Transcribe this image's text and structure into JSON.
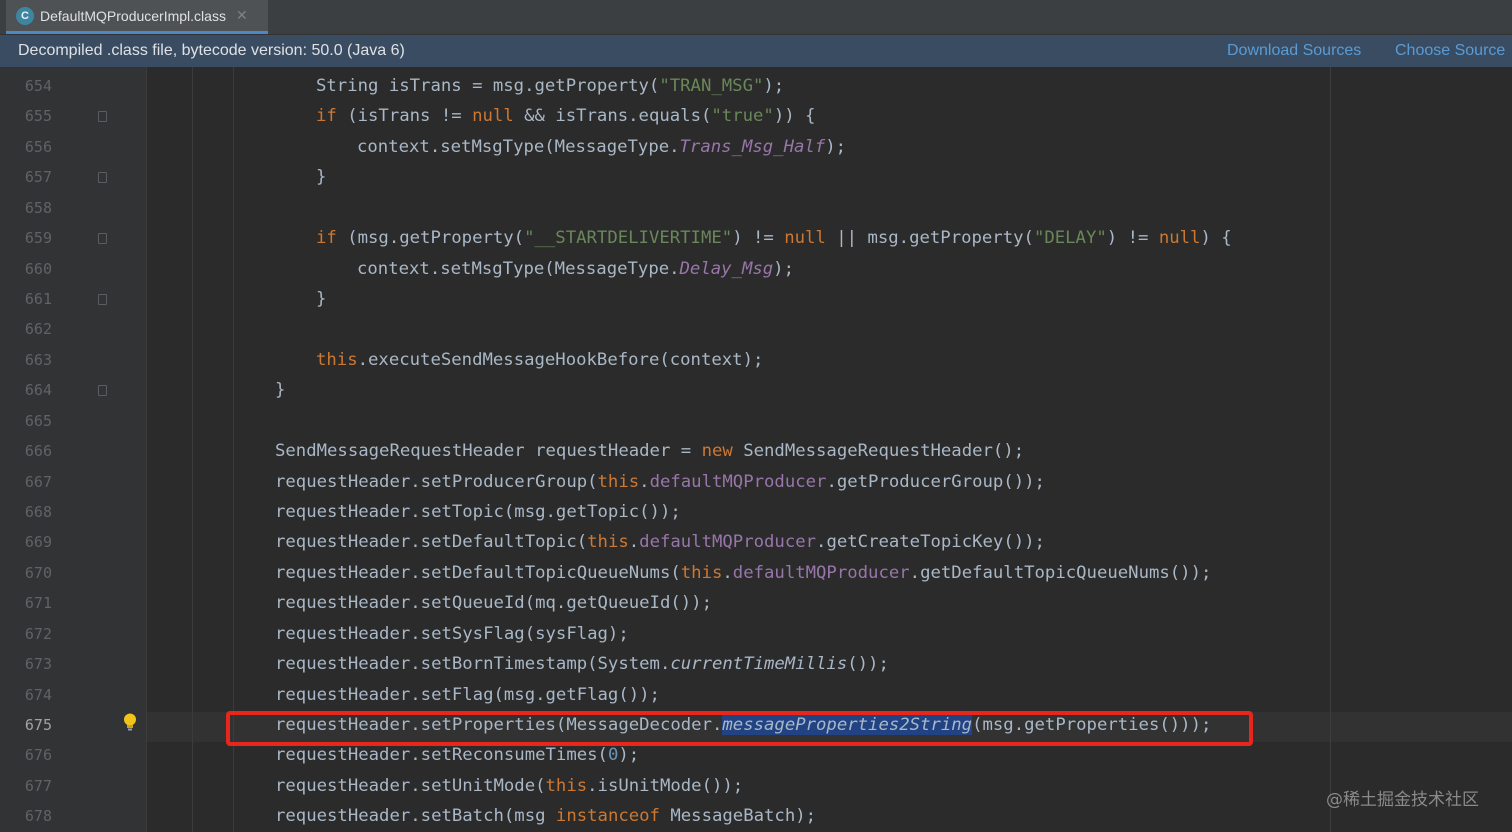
{
  "tab": {
    "icon_letter": "C",
    "file_name": "DefaultMQProducerImpl.class",
    "close_glyph": "✕"
  },
  "info_bar": {
    "text": "Decompiled .class file, bytecode version: 50.0 (Java 6)",
    "download_sources": "Download Sources",
    "choose_sources": "Choose Source"
  },
  "editor": {
    "current_line": 675,
    "line_numbers": [
      "654",
      "655",
      "656",
      "657",
      "658",
      "659",
      "660",
      "661",
      "662",
      "663",
      "664",
      "665",
      "666",
      "667",
      "668",
      "669",
      "670",
      "671",
      "672",
      "673",
      "674",
      "675",
      "676",
      "677",
      "678"
    ]
  },
  "code": {
    "l654": [
      {
        "t": "String isTrans = msg.getProperty("
      },
      {
        "t": "\"TRAN_MSG\"",
        "c": "str"
      },
      {
        "t": ");"
      }
    ],
    "l655": [
      {
        "t": "if",
        "c": "kw"
      },
      {
        "t": " (isTrans != "
      },
      {
        "t": "null",
        "c": "kw"
      },
      {
        "t": " && isTrans.equals("
      },
      {
        "t": "\"true\"",
        "c": "str"
      },
      {
        "t": ")) {"
      }
    ],
    "l656": [
      {
        "t": "context.setMsgType(MessageType."
      },
      {
        "t": "Trans_Msg_Half",
        "c": "ifld"
      },
      {
        "t": ");"
      }
    ],
    "l657": [
      {
        "t": "}"
      }
    ],
    "l658": [],
    "l659": [
      {
        "t": "if",
        "c": "kw"
      },
      {
        "t": " (msg.getProperty("
      },
      {
        "t": "\"__STARTDELIVERTIME\"",
        "c": "str"
      },
      {
        "t": ") != "
      },
      {
        "t": "null",
        "c": "kw"
      },
      {
        "t": " || msg.getProperty("
      },
      {
        "t": "\"DELAY\"",
        "c": "str"
      },
      {
        "t": ") != "
      },
      {
        "t": "null",
        "c": "kw"
      },
      {
        "t": ") {"
      }
    ],
    "l660": [
      {
        "t": "context.setMsgType(MessageType."
      },
      {
        "t": "Delay_Msg",
        "c": "ifld"
      },
      {
        "t": ");"
      }
    ],
    "l661": [
      {
        "t": "}"
      }
    ],
    "l662": [],
    "l663": [
      {
        "t": "this",
        "c": "kw"
      },
      {
        "t": ".executeSendMessageHookBefore(context);"
      }
    ],
    "l664": [
      {
        "t": "}"
      }
    ],
    "l665": [],
    "l666": [
      {
        "t": "SendMessageRequestHeader requestHeader = "
      },
      {
        "t": "new",
        "c": "kw"
      },
      {
        "t": " SendMessageRequestHeader();"
      }
    ],
    "l667": [
      {
        "t": "requestHeader.setProducerGroup("
      },
      {
        "t": "this",
        "c": "kw"
      },
      {
        "t": "."
      },
      {
        "t": "defaultMQProducer",
        "c": "fld"
      },
      {
        "t": ".getProducerGroup());"
      }
    ],
    "l668": [
      {
        "t": "requestHeader.setTopic(msg.getTopic());"
      }
    ],
    "l669": [
      {
        "t": "requestHeader.setDefaultTopic("
      },
      {
        "t": "this",
        "c": "kw"
      },
      {
        "t": "."
      },
      {
        "t": "defaultMQProducer",
        "c": "fld"
      },
      {
        "t": ".getCreateTopicKey());"
      }
    ],
    "l670": [
      {
        "t": "requestHeader.setDefaultTopicQueueNums("
      },
      {
        "t": "this",
        "c": "kw"
      },
      {
        "t": "."
      },
      {
        "t": "defaultMQProducer",
        "c": "fld"
      },
      {
        "t": ".getDefaultTopicQueueNums());"
      }
    ],
    "l671": [
      {
        "t": "requestHeader.setQueueId(mq.getQueueId());"
      }
    ],
    "l672": [
      {
        "t": "requestHeader.setSysFlag(sysFlag);"
      }
    ],
    "l673": [
      {
        "t": "requestHeader.setBornTimestamp(System."
      },
      {
        "t": "currentTimeMillis",
        "c": "it"
      },
      {
        "t": "());"
      }
    ],
    "l674": [
      {
        "t": "requestHeader.setFlag(msg.getFlag());"
      }
    ],
    "l675": [
      {
        "t": "requestHeader.setProperties(MessageDecoder."
      },
      {
        "t": "messageProperties2String",
        "c": "sel"
      },
      {
        "t": "(msg.getProperties()));"
      }
    ],
    "l676": [
      {
        "t": "requestHeader.setReconsumeTimes("
      },
      {
        "t": "0",
        "c": "num"
      },
      {
        "t": ");"
      }
    ],
    "l677": [
      {
        "t": "requestHeader.setUnitMode("
      },
      {
        "t": "this",
        "c": "kw"
      },
      {
        "t": ".isUnitMode());"
      }
    ],
    "l678": [
      {
        "t": "requestHeader.setBatch(msg "
      },
      {
        "t": "instanceof",
        "c": "kw"
      },
      {
        "t": " MessageBatch);"
      }
    ]
  },
  "watermark": "@稀土掘金技术社区",
  "colors": {
    "background": "#2b2b2b",
    "gutter": "#313335",
    "keyword": "#cc7832",
    "string": "#6a8759",
    "field": "#9876aa",
    "number": "#6897bb",
    "default_text": "#a9b7c6",
    "selection": "#214283",
    "highlight_box": "#e8261b",
    "info_bar": "#394c61",
    "link": "#5b9bd5"
  },
  "icons": {
    "tab": "class-file-icon",
    "intention": "lightbulb-icon",
    "fold": "fold-marker-icon",
    "close": "close-icon"
  }
}
